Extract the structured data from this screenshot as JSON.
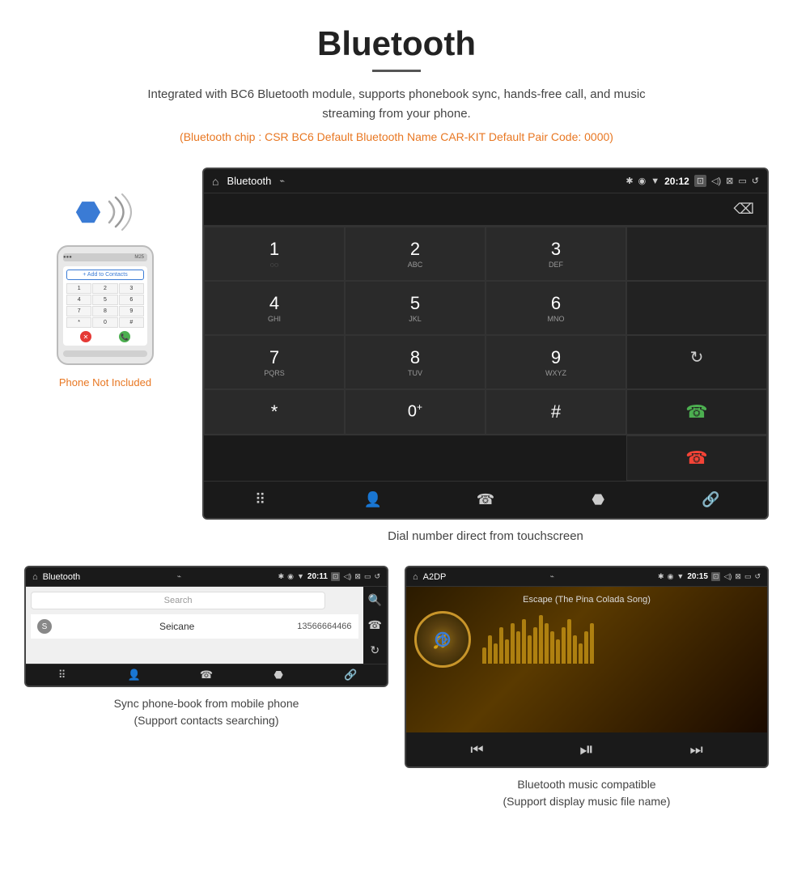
{
  "page": {
    "title": "Bluetooth",
    "subtitle": "Integrated with BC6 Bluetooth module, supports phonebook sync, hands-free call, and music streaming from your phone.",
    "specs": "(Bluetooth chip : CSR BC6    Default Bluetooth Name CAR-KIT    Default Pair Code: 0000)",
    "main_caption": "Dial number direct from touchscreen",
    "phone_not_included": "Phone Not Included"
  },
  "main_screen": {
    "status_bar": {
      "title": "Bluetooth",
      "usb_icon": "⌁",
      "time": "20:12",
      "bt_icon": "✱",
      "location": "◉",
      "signal": "▼",
      "camera": "⊡",
      "volume": "◁",
      "close": "⊠",
      "screen": "▭",
      "back": "↺"
    },
    "dialpad": {
      "keys": [
        {
          "main": "1",
          "sub": "◌◌"
        },
        {
          "main": "2",
          "sub": "ABC"
        },
        {
          "main": "3",
          "sub": "DEF"
        },
        {
          "main": "",
          "sub": ""
        },
        {
          "main": "4",
          "sub": "GHI"
        },
        {
          "main": "5",
          "sub": "JKL"
        },
        {
          "main": "6",
          "sub": "MNO"
        },
        {
          "main": "",
          "sub": ""
        },
        {
          "main": "7",
          "sub": "PQRS"
        },
        {
          "main": "8",
          "sub": "TUV"
        },
        {
          "main": "9",
          "sub": "WXYZ"
        },
        {
          "main": "↻",
          "sub": ""
        },
        {
          "main": "*",
          "sub": ""
        },
        {
          "main": "0",
          "sub": "+"
        },
        {
          "main": "#",
          "sub": ""
        },
        {
          "main": "call",
          "sub": ""
        },
        {
          "main": "endcall",
          "sub": ""
        }
      ]
    },
    "bottom_nav": [
      "⠿",
      "👤",
      "📞",
      "✱",
      "🔗"
    ]
  },
  "phonebook_screen": {
    "status": {
      "title": "Bluetooth",
      "time": "20:11"
    },
    "search_placeholder": "Search",
    "contacts": [
      {
        "letter": "S",
        "name": "Seicane",
        "number": "13566664466"
      }
    ],
    "caption": "Sync phone-book from mobile phone\n(Support contacts searching)"
  },
  "music_screen": {
    "status": {
      "title": "A2DP",
      "time": "20:15"
    },
    "song_title": "Escape (The Pina Colada Song)",
    "viz_bars": [
      20,
      35,
      25,
      45,
      30,
      50,
      40,
      55,
      35,
      45,
      60,
      50,
      40,
      30,
      45,
      55,
      35,
      25,
      40,
      50
    ],
    "caption": "Bluetooth music compatible\n(Support display music file name)"
  }
}
